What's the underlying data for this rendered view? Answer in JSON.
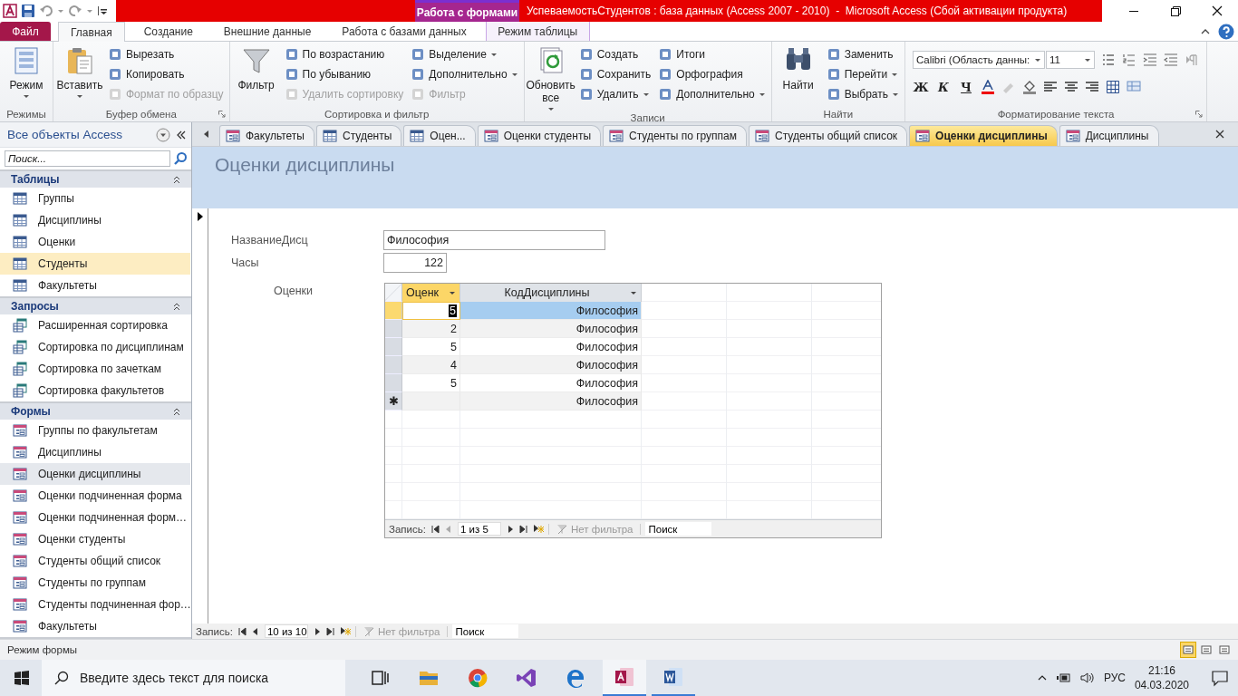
{
  "title_bar": {
    "context_label": "Работа с формами",
    "title": "УспеваемостьСтудентов : база данных (Access 2007 - 2010)  -  Microsoft Access (Сбой активации продукта)"
  },
  "ribbon_tabs": [
    {
      "label": "Файл",
      "kind": "file",
      "selected": false
    },
    {
      "label": "Главная",
      "kind": "normal",
      "selected": true
    },
    {
      "label": "Создание",
      "kind": "normal",
      "selected": false
    },
    {
      "label": "Внешние данные",
      "kind": "normal",
      "selected": false
    },
    {
      "label": "Работа с базами данных",
      "kind": "normal",
      "selected": false
    },
    {
      "label": "Режим таблицы",
      "kind": "context",
      "selected": false
    }
  ],
  "ribbon_groups": [
    {
      "kind": "standard",
      "title": "Режимы",
      "launcher": false,
      "large": [
        {
          "label": "Режим",
          "dropdown": true
        }
      ]
    },
    {
      "kind": "standard",
      "title": "Буфер обмена",
      "launcher": true,
      "large": [
        {
          "label": "Вставить",
          "dropdown": true
        }
      ],
      "columns": [
        [
          {
            "label": "Вырезать",
            "disabled": false,
            "dropdown": false
          },
          {
            "label": "Копировать",
            "disabled": false,
            "dropdown": false
          },
          {
            "label": "Формат по образцу",
            "disabled": true,
            "dropdown": false
          }
        ]
      ]
    },
    {
      "kind": "standard",
      "title": "Сортировка и фильтр",
      "launcher": false,
      "large": [
        {
          "label": "Фильтр",
          "dropdown": false
        }
      ],
      "columns": [
        [
          {
            "label": "По возрастанию",
            "disabled": false,
            "dropdown": false
          },
          {
            "label": "По убыванию",
            "disabled": false,
            "dropdown": false
          },
          {
            "label": "Удалить сортировку",
            "disabled": true,
            "dropdown": false
          }
        ],
        [
          {
            "label": "Выделение",
            "disabled": false,
            "dropdown": true
          },
          {
            "label": "Дополнительно",
            "disabled": false,
            "dropdown": true
          },
          {
            "label": "Фильтр",
            "disabled": true,
            "dropdown": false
          }
        ]
      ]
    },
    {
      "kind": "standard",
      "title": "Записи",
      "launcher": false,
      "large": [
        {
          "label": "Обновить все",
          "dropdown": true
        }
      ],
      "columns": [
        [
          {
            "label": "Создать",
            "disabled": false,
            "dropdown": false
          },
          {
            "label": "Сохранить",
            "disabled": false,
            "dropdown": false
          },
          {
            "label": "Удалить",
            "disabled": false,
            "dropdown": true
          }
        ],
        [
          {
            "label": "Итоги",
            "disabled": false,
            "dropdown": false
          },
          {
            "label": "Орфография",
            "disabled": false,
            "dropdown": false
          },
          {
            "label": "Дополнительно",
            "disabled": false,
            "dropdown": true
          }
        ]
      ]
    },
    {
      "kind": "standard",
      "title": "Найти",
      "launcher": false,
      "large": [
        {
          "label": "Найти",
          "dropdown": false
        }
      ],
      "columns": [
        [
          {
            "label": "Заменить",
            "disabled": false,
            "dropdown": false
          },
          {
            "label": "Перейти",
            "disabled": false,
            "dropdown": true
          },
          {
            "label": "Выбрать",
            "disabled": false,
            "dropdown": true
          }
        ]
      ]
    },
    {
      "kind": "format",
      "title": "Форматирование текста",
      "launcher": true,
      "font": "Calibri (Область данны:",
      "size": "11",
      "style_buttons": [
        "Ж",
        "К",
        "Ч"
      ]
    }
  ],
  "doc_tabs": [
    {
      "label": "Факультеты",
      "kind": "form",
      "selected": false
    },
    {
      "label": "Студенты",
      "kind": "table",
      "selected": false
    },
    {
      "label": "Оцен...",
      "kind": "table",
      "selected": false
    },
    {
      "label": "Оценки студенты",
      "kind": "form",
      "selected": false
    },
    {
      "label": "Студенты по группам",
      "kind": "form",
      "selected": false
    },
    {
      "label": "Студенты общий список",
      "kind": "form",
      "selected": false
    },
    {
      "label": "Оценки дисциплины",
      "kind": "form",
      "selected": true
    },
    {
      "label": "Дисциплины",
      "kind": "form",
      "selected": false
    }
  ],
  "nav_pane": {
    "title": "Все объекты Access",
    "search_placeholder": "Поиск...",
    "sections": [
      {
        "title": "Таблицы",
        "kind": "table",
        "items": [
          {
            "label": "Группы",
            "selected": false,
            "current": false
          },
          {
            "label": "Дисциплины",
            "selected": false,
            "current": false
          },
          {
            "label": "Оценки",
            "selected": false,
            "current": false
          },
          {
            "label": "Студенты",
            "selected": true,
            "current": false
          },
          {
            "label": "Факультеты",
            "selected": false,
            "current": false
          }
        ]
      },
      {
        "title": "Запросы",
        "kind": "query",
        "items": [
          {
            "label": "Расширенная сортировка",
            "selected": false,
            "current": false
          },
          {
            "label": "Сортировка по дисциплинам",
            "selected": false,
            "current": false
          },
          {
            "label": "Сортировка по зачеткам",
            "selected": false,
            "current": false
          },
          {
            "label": "Сортировка факультетов",
            "selected": false,
            "current": false
          }
        ]
      },
      {
        "title": "Формы",
        "kind": "form",
        "items": [
          {
            "label": "Группы по факультетам",
            "selected": false,
            "current": false
          },
          {
            "label": "Дисциплины",
            "selected": false,
            "current": false
          },
          {
            "label": "Оценки дисциплины",
            "selected": false,
            "current": true
          },
          {
            "label": "Оценки подчиненная форма",
            "selected": false,
            "current": false
          },
          {
            "label": "Оценки подчиненная форм…",
            "selected": false,
            "current": false
          },
          {
            "label": "Оценки студенты",
            "selected": false,
            "current": false
          },
          {
            "label": "Студенты общий список",
            "selected": false,
            "current": false
          },
          {
            "label": "Студенты по группам",
            "selected": false,
            "current": false
          },
          {
            "label": "Студенты подчиненная фор…",
            "selected": false,
            "current": false
          },
          {
            "label": "Факультеты",
            "selected": false,
            "current": false
          }
        ]
      }
    ]
  },
  "form": {
    "title": "Оценки дисциплины",
    "fields": [
      {
        "label": "НазваниеДисц",
        "value": "Философия",
        "kind": "text"
      },
      {
        "label": "Часы",
        "value": "122",
        "kind": "number"
      }
    ],
    "subform": {
      "label": "Оценки",
      "columns": [
        {
          "label": "Оценк",
          "selected": true
        },
        {
          "label": "КодДисциплины",
          "selected": false
        }
      ],
      "rows": [
        {
          "grade": "5",
          "discipline": "Философия",
          "selected": true
        },
        {
          "grade": "2",
          "discipline": "Философия",
          "selected": false
        },
        {
          "grade": "5",
          "discipline": "Философия",
          "selected": false
        },
        {
          "grade": "4",
          "discipline": "Философия",
          "selected": false
        },
        {
          "grade": "5",
          "discipline": "Философия",
          "selected": false
        }
      ],
      "new_row": {
        "marker": "✱",
        "discipline": "Философия"
      },
      "nav": {
        "label": "Запись:",
        "position": "1 из 5",
        "filter": "Нет фильтра",
        "search": "Поиск"
      }
    }
  },
  "record_nav": {
    "label": "Запись:",
    "position": "10 из 10",
    "filter": "Нет фильтра",
    "search": "Поиск"
  },
  "status_bar": {
    "text": "Режим формы",
    "views": [
      {
        "selected": true
      },
      {
        "selected": false
      },
      {
        "selected": false
      }
    ]
  },
  "taskbar": {
    "search_placeholder": "Введите здесь текст для поиска",
    "apps": [
      {
        "kind": "taskview",
        "active": false,
        "running": false
      },
      {
        "kind": "folder",
        "active": false,
        "running": false
      },
      {
        "kind": "browser",
        "active": false,
        "running": false
      },
      {
        "kind": "studio",
        "active": false,
        "running": false
      },
      {
        "kind": "edge",
        "active": false,
        "running": false
      },
      {
        "kind": "access",
        "active": true,
        "running": true
      },
      {
        "kind": "word",
        "active": false,
        "running": true
      }
    ],
    "language": "РУС",
    "time": "21:16",
    "date": "04.03.2020"
  }
}
